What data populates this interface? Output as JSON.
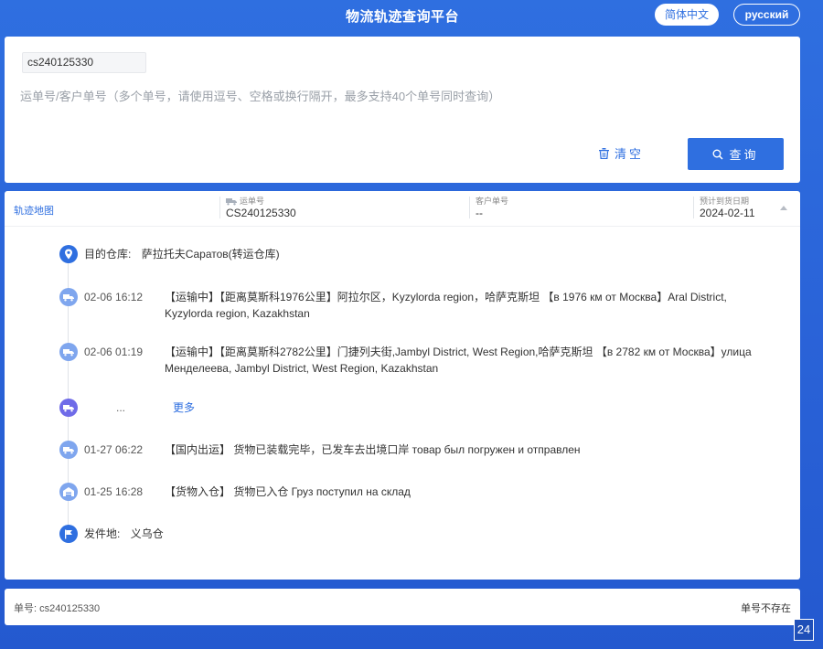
{
  "header": {
    "title": "物流轨迹查询平台",
    "lang_zh": "简体中文",
    "lang_ru": "русский"
  },
  "search": {
    "chip_value": "cs240125330",
    "placeholder": "运单号/客户单号（多个单号，请使用逗号、空格或换行隔开，最多支持40个单号同时查询）",
    "clear_label": "清空",
    "query_label": "查询"
  },
  "result": {
    "map_link": "轨迹地图",
    "waybill_label": "运单号",
    "waybill_value": "CS240125330",
    "customer_label": "客户单号",
    "customer_value": "--",
    "eta_label": "预计到货日期",
    "eta_value": "2024-02-11",
    "destination_label": "目的仓库:",
    "destination_value": "萨拉托夫Саратов(转运仓库)",
    "events": [
      {
        "time": "02-06 16:12",
        "desc": "【运输中】【距离莫斯科1976公里】阿拉尔区，Kyzylorda region，哈萨克斯坦 【в 1976 км от Москва】Aral District, Kyzylorda region, Kazakhstan"
      },
      {
        "time": "02-06 01:19",
        "desc": "【运输中】【距离莫斯科2782公里】门捷列夫街,Jambyl District, West Region,哈萨克斯坦 【в 2782 км от Москва】улица Менделеева, Jambyl District, West Region, Kazakhstan"
      },
      {
        "time": "01-27 06:22",
        "desc": "【国内出运】 货物已装载完毕，已发车去出境口岸 товар был погружен и отправлен"
      },
      {
        "time": "01-25 16:28",
        "desc": "【货物入仓】 货物已入仓 Груз поступил на склад"
      }
    ],
    "more_dots": "...",
    "more_label": "更多",
    "origin_label": "发件地:",
    "origin_value": "义乌仓"
  },
  "footer": {
    "order_text": "单号: cs240125330",
    "status_text": "单号不存在"
  },
  "corner_badge": "24",
  "colors": {
    "accent": "#2f6fe0",
    "timeline_icon": "#7fa6ee"
  }
}
